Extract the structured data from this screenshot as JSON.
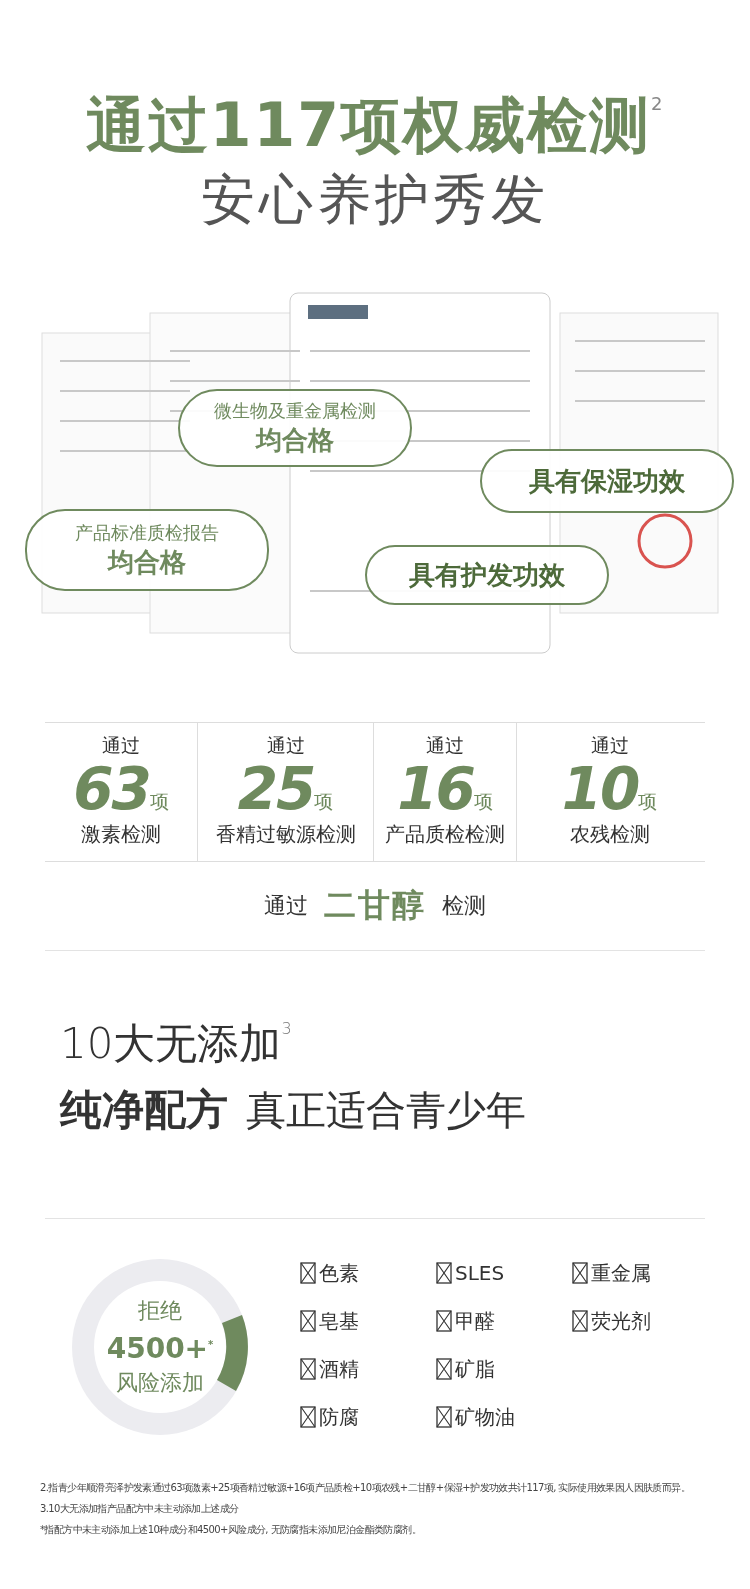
{
  "heading": {
    "title": "通过117项权威检测$^{2}$",
    "subtitle": "安心养护秀发"
  },
  "reports": {
    "kind": "picture",
    "callouts": [
      {
        "label": "微生物及重金属检测",
        "result": "均合格"
      },
      {
        "result": "具有保湿功效"
      },
      {
        "label": "产品标准质检报告",
        "result": "均合格"
      },
      {
        "result": "具有护发功效"
      }
    ]
  },
  "stats": [
    {
      "prefix": "通过",
      "number": "63",
      "unit": "项",
      "label": "激素检测"
    },
    {
      "prefix": "通过",
      "number": "25",
      "unit": "项",
      "label": "香精过敏源检测"
    },
    {
      "prefix": "通过",
      "number": "16",
      "unit": "项",
      "label": "产品质检检测"
    },
    {
      "prefix": "通过",
      "number": "10",
      "unit": "项",
      "label": "农残检测"
    }
  ],
  "extra_test": {
    "prefix": "通过",
    "highlight": "二甘醇",
    "suffix": "检测"
  },
  "additives": {
    "title": "10大无添加$^{3}$",
    "tagline_bold": "纯净配方",
    "tagline": "真正适合青少年"
  },
  "ring": {
    "line1": "拒绝",
    "line2": "4500+$^{*}$",
    "line3": "风险添加"
  },
  "excluded_columns": [
    [
      "色素",
      "皂基",
      "酒精",
      "防腐"
    ],
    [
      "SLES",
      "甲醛",
      "矿脂",
      "矿物油"
    ],
    [
      "重金属",
      "荧光剂"
    ]
  ],
  "notes": [
    "2.指青少年顺滑亮泽护发素通过63项激素+25项香精过敏源+16项产品质检+10项农残+二甘醇+保湿+护发功效共计117项, 实际使用效果因人因肤质而异。",
    "3.10大无添加指产品配方中未主动添加上述成分",
    "*指配方中未主动添加上述10种成分和4500+风险成分, 无防腐指未添加尼泊金酯类防腐剂。"
  ]
}
